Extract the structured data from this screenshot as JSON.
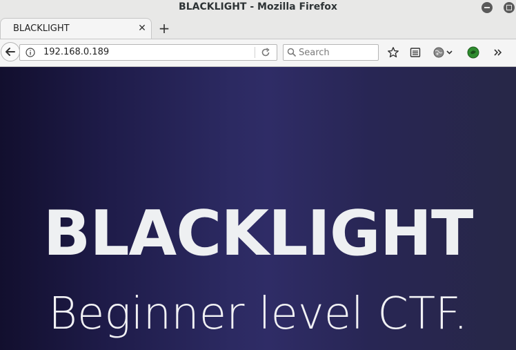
{
  "window": {
    "title": "BLACKLIGHT - Mozilla Firefox"
  },
  "tabs": [
    {
      "label": "BLACKLIGHT",
      "active": true
    }
  ],
  "navbar": {
    "url": "192.168.0.189",
    "search_placeholder": "Search"
  },
  "page": {
    "title": "BLACKLIGHT",
    "subtitle": "Beginner level CTF."
  },
  "colors": {
    "gradient_dark": "#120f2e",
    "gradient_mid": "#2f2c66",
    "hero_text": "#eef0f2",
    "chrome_bg": "#e8e8e7"
  },
  "icons": [
    "minimize-icon",
    "maximize-icon",
    "tab-close-icon",
    "new-tab-icon",
    "back-arrow-icon",
    "info-icon",
    "reload-icon",
    "search-icon",
    "bookmark-star-icon",
    "reader-list-icon",
    "theme-globe-icon",
    "chevron-down-icon",
    "addon-shield-icon",
    "overflow-chevrons-icon"
  ]
}
